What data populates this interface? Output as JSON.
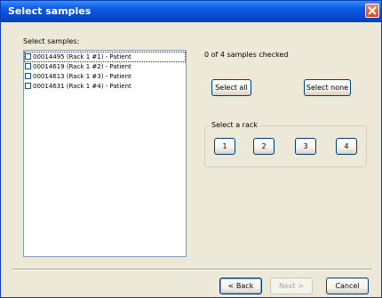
{
  "window": {
    "title": "Select samples"
  },
  "samples_label": "Select samples:",
  "samples": [
    {
      "label": "00014495 (Rack 1 #1) - Patient",
      "checked": false
    },
    {
      "label": "00014619 (Rack 1 #2) - Patient",
      "checked": false
    },
    {
      "label": "00014613 (Rack 1 #3) - Patient",
      "checked": false
    },
    {
      "label": "00014631 (Rack 1 #4) - Patient",
      "checked": false
    }
  ],
  "status_text": "0 of 4 samples checked",
  "buttons": {
    "select_all": "Select all",
    "select_none": "Select none",
    "back": "< Back",
    "next": "Next >",
    "cancel": "Cancel"
  },
  "rack_group": {
    "legend": "Select a rack",
    "racks": [
      "1",
      "2",
      "3",
      "4"
    ]
  },
  "colors": {
    "titlebar": "#0a3fb4",
    "dialog_bg": "#ece9d8",
    "close_button": "#cf4a24"
  }
}
